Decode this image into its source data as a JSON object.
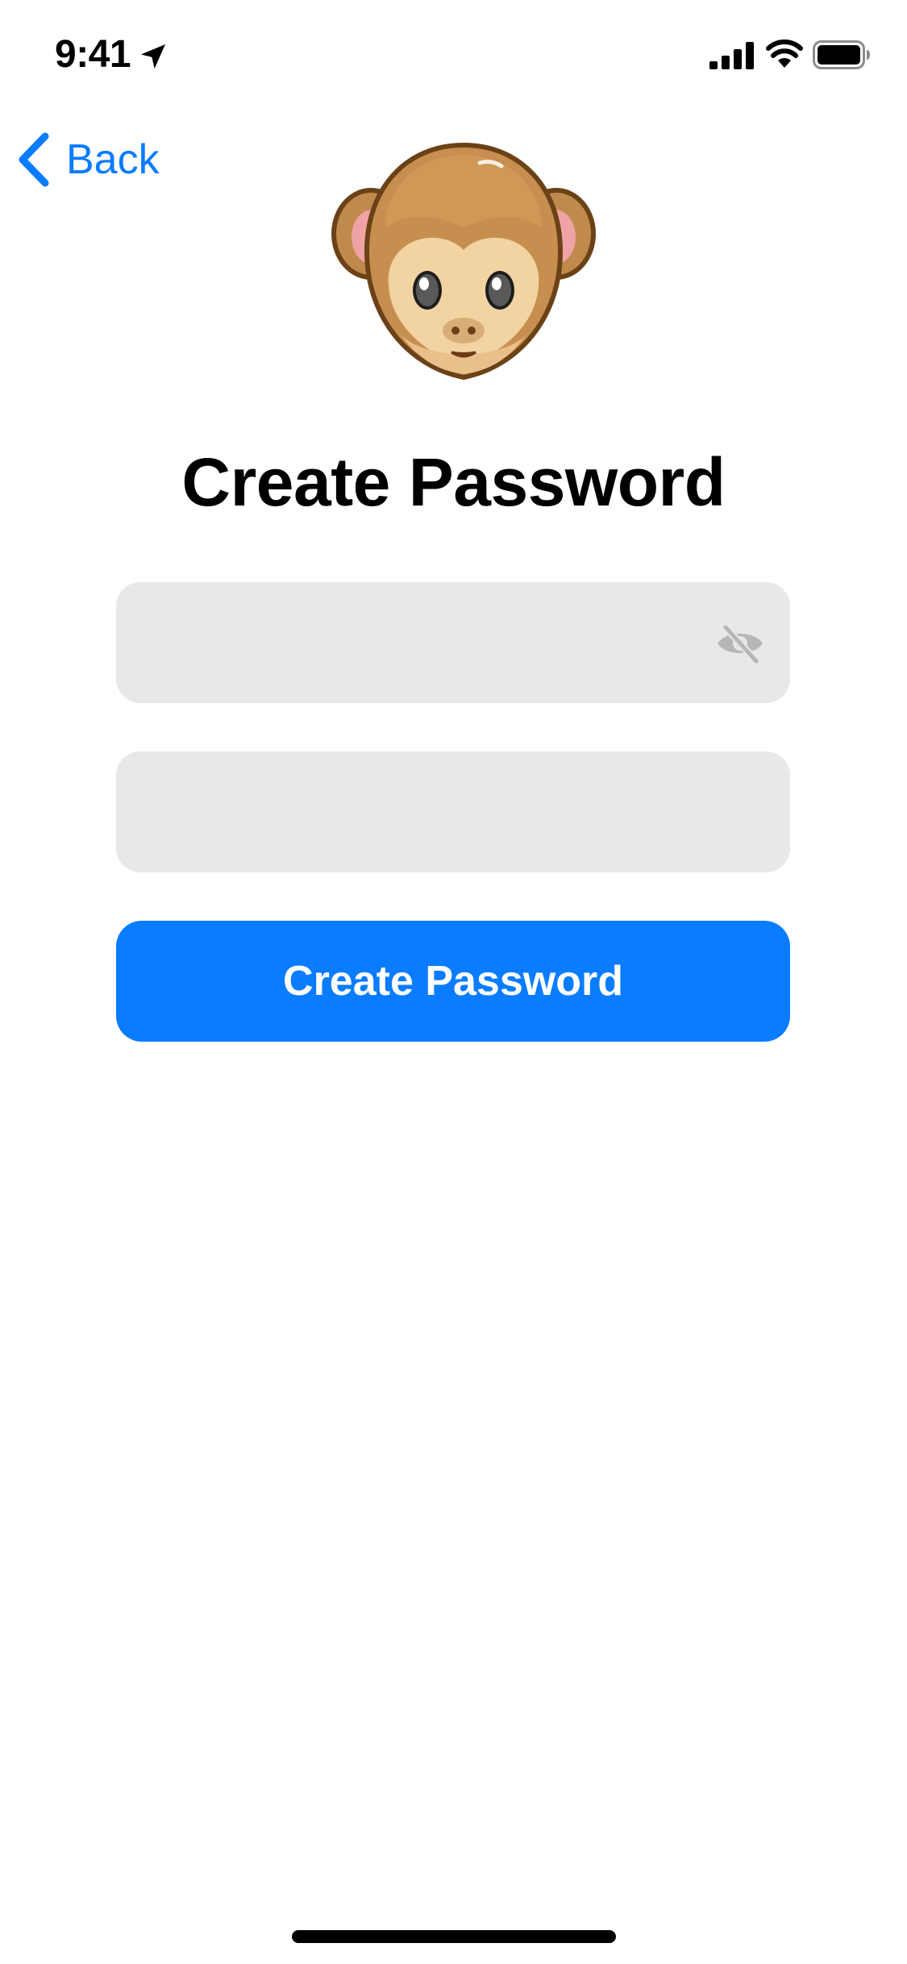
{
  "status_bar": {
    "time": "9:41",
    "icons": [
      "location-arrow-icon",
      "cellular-signal-icon",
      "wifi-icon",
      "battery-icon"
    ]
  },
  "nav": {
    "back_label": "Back",
    "back_icon": "chevron-left-icon"
  },
  "header": {
    "illustration": "monkey-face-icon",
    "title": "Create Password"
  },
  "form": {
    "password": {
      "value": "",
      "placeholder": "",
      "toggle_icon": "eye-slash-icon"
    },
    "confirm_password": {
      "value": "",
      "placeholder": ""
    },
    "submit_label": "Create Password"
  },
  "colors": {
    "accent": "#0a7cff",
    "field_background": "#e8e8e9",
    "background": "#ffffff"
  }
}
